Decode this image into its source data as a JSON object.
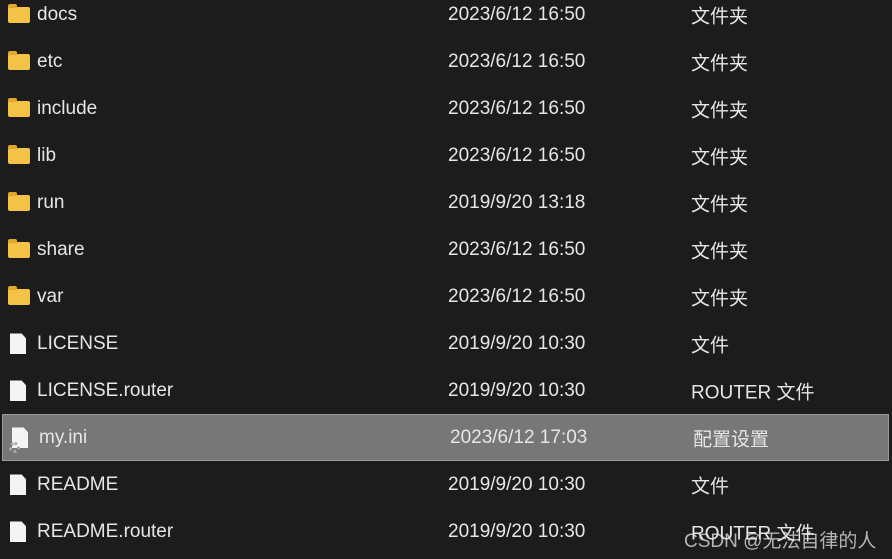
{
  "files": [
    {
      "name": "docs",
      "date": "2023/6/12 16:50",
      "type": "文件夹",
      "kind": "folder"
    },
    {
      "name": "etc",
      "date": "2023/6/12 16:50",
      "type": "文件夹",
      "kind": "folder"
    },
    {
      "name": "include",
      "date": "2023/6/12 16:50",
      "type": "文件夹",
      "kind": "folder"
    },
    {
      "name": "lib",
      "date": "2023/6/12 16:50",
      "type": "文件夹",
      "kind": "folder"
    },
    {
      "name": "run",
      "date": "2019/9/20 13:18",
      "type": "文件夹",
      "kind": "folder"
    },
    {
      "name": "share",
      "date": "2023/6/12 16:50",
      "type": "文件夹",
      "kind": "folder"
    },
    {
      "name": "var",
      "date": "2023/6/12 16:50",
      "type": "文件夹",
      "kind": "folder"
    },
    {
      "name": "LICENSE",
      "date": "2019/9/20 10:30",
      "type": "文件",
      "kind": "file"
    },
    {
      "name": "LICENSE.router",
      "date": "2019/9/20 10:30",
      "type": "ROUTER 文件",
      "kind": "file"
    },
    {
      "name": "my.ini",
      "date": "2023/6/12 17:03",
      "type": "配置设置",
      "kind": "config",
      "selected": true
    },
    {
      "name": "README",
      "date": "2019/9/20 10:30",
      "type": "文件",
      "kind": "file"
    },
    {
      "name": "README.router",
      "date": "2019/9/20 10:30",
      "type": "ROUTER 文件",
      "kind": "file"
    }
  ],
  "watermark": "CSDN @无法自律的人"
}
